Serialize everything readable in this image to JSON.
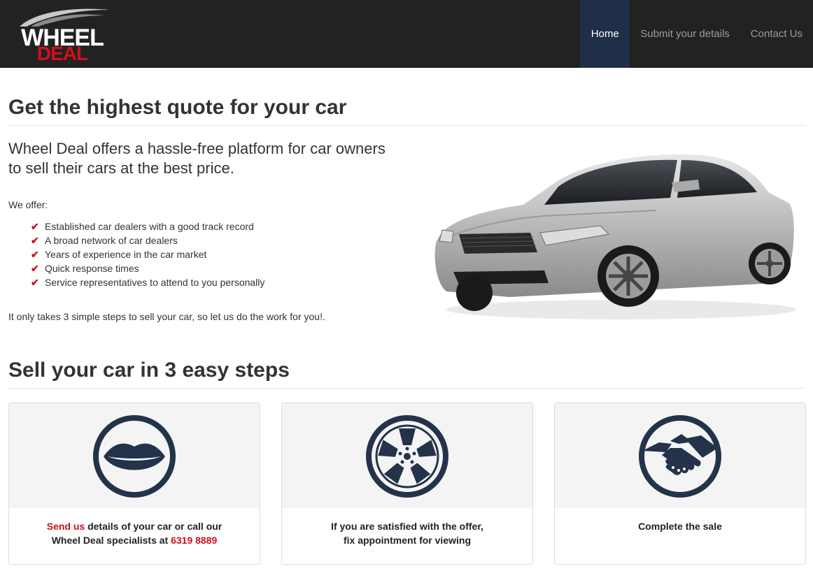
{
  "brand": {
    "line1": "WHEEL",
    "line2": "DEAL",
    "accent_color": "#d0101b"
  },
  "nav": {
    "items": [
      {
        "label": "Home",
        "active": true
      },
      {
        "label": "Submit your details",
        "active": false
      },
      {
        "label": "Contact Us",
        "active": false
      }
    ]
  },
  "intro": {
    "heading": "Get the highest quote for your car",
    "lead": "Wheel Deal offers a hassle-free platform for car owners to sell their cars at the best price.",
    "offer_label": "We offer:",
    "offers": [
      "Established car dealers with a good track record",
      "A broad network of car dealers",
      "Years of experience in the car market",
      "Quick response times",
      "Service representatives to attend to you personally"
    ],
    "closing": "It only takes 3 simple steps to sell your car, so let us do the work for you!."
  },
  "steps": {
    "heading": "Sell your car in 3 easy steps",
    "cards": [
      {
        "icon": "lips-icon",
        "link_text": "Send us",
        "text_a": " details of your car or call our",
        "text_b": "Wheel Deal specialists at ",
        "phone": "6319 8889"
      },
      {
        "icon": "wheel-icon",
        "line1": "If you are satisfied with the offer,",
        "line2": "fix appointment for viewing"
      },
      {
        "icon": "handshake-icon",
        "line1": "Complete the sale"
      }
    ]
  },
  "colors": {
    "navbar_bg": "#222222",
    "nav_active_bg": "#1f2f48",
    "icon_navy": "#24324a",
    "check_red": "#c9101e"
  }
}
